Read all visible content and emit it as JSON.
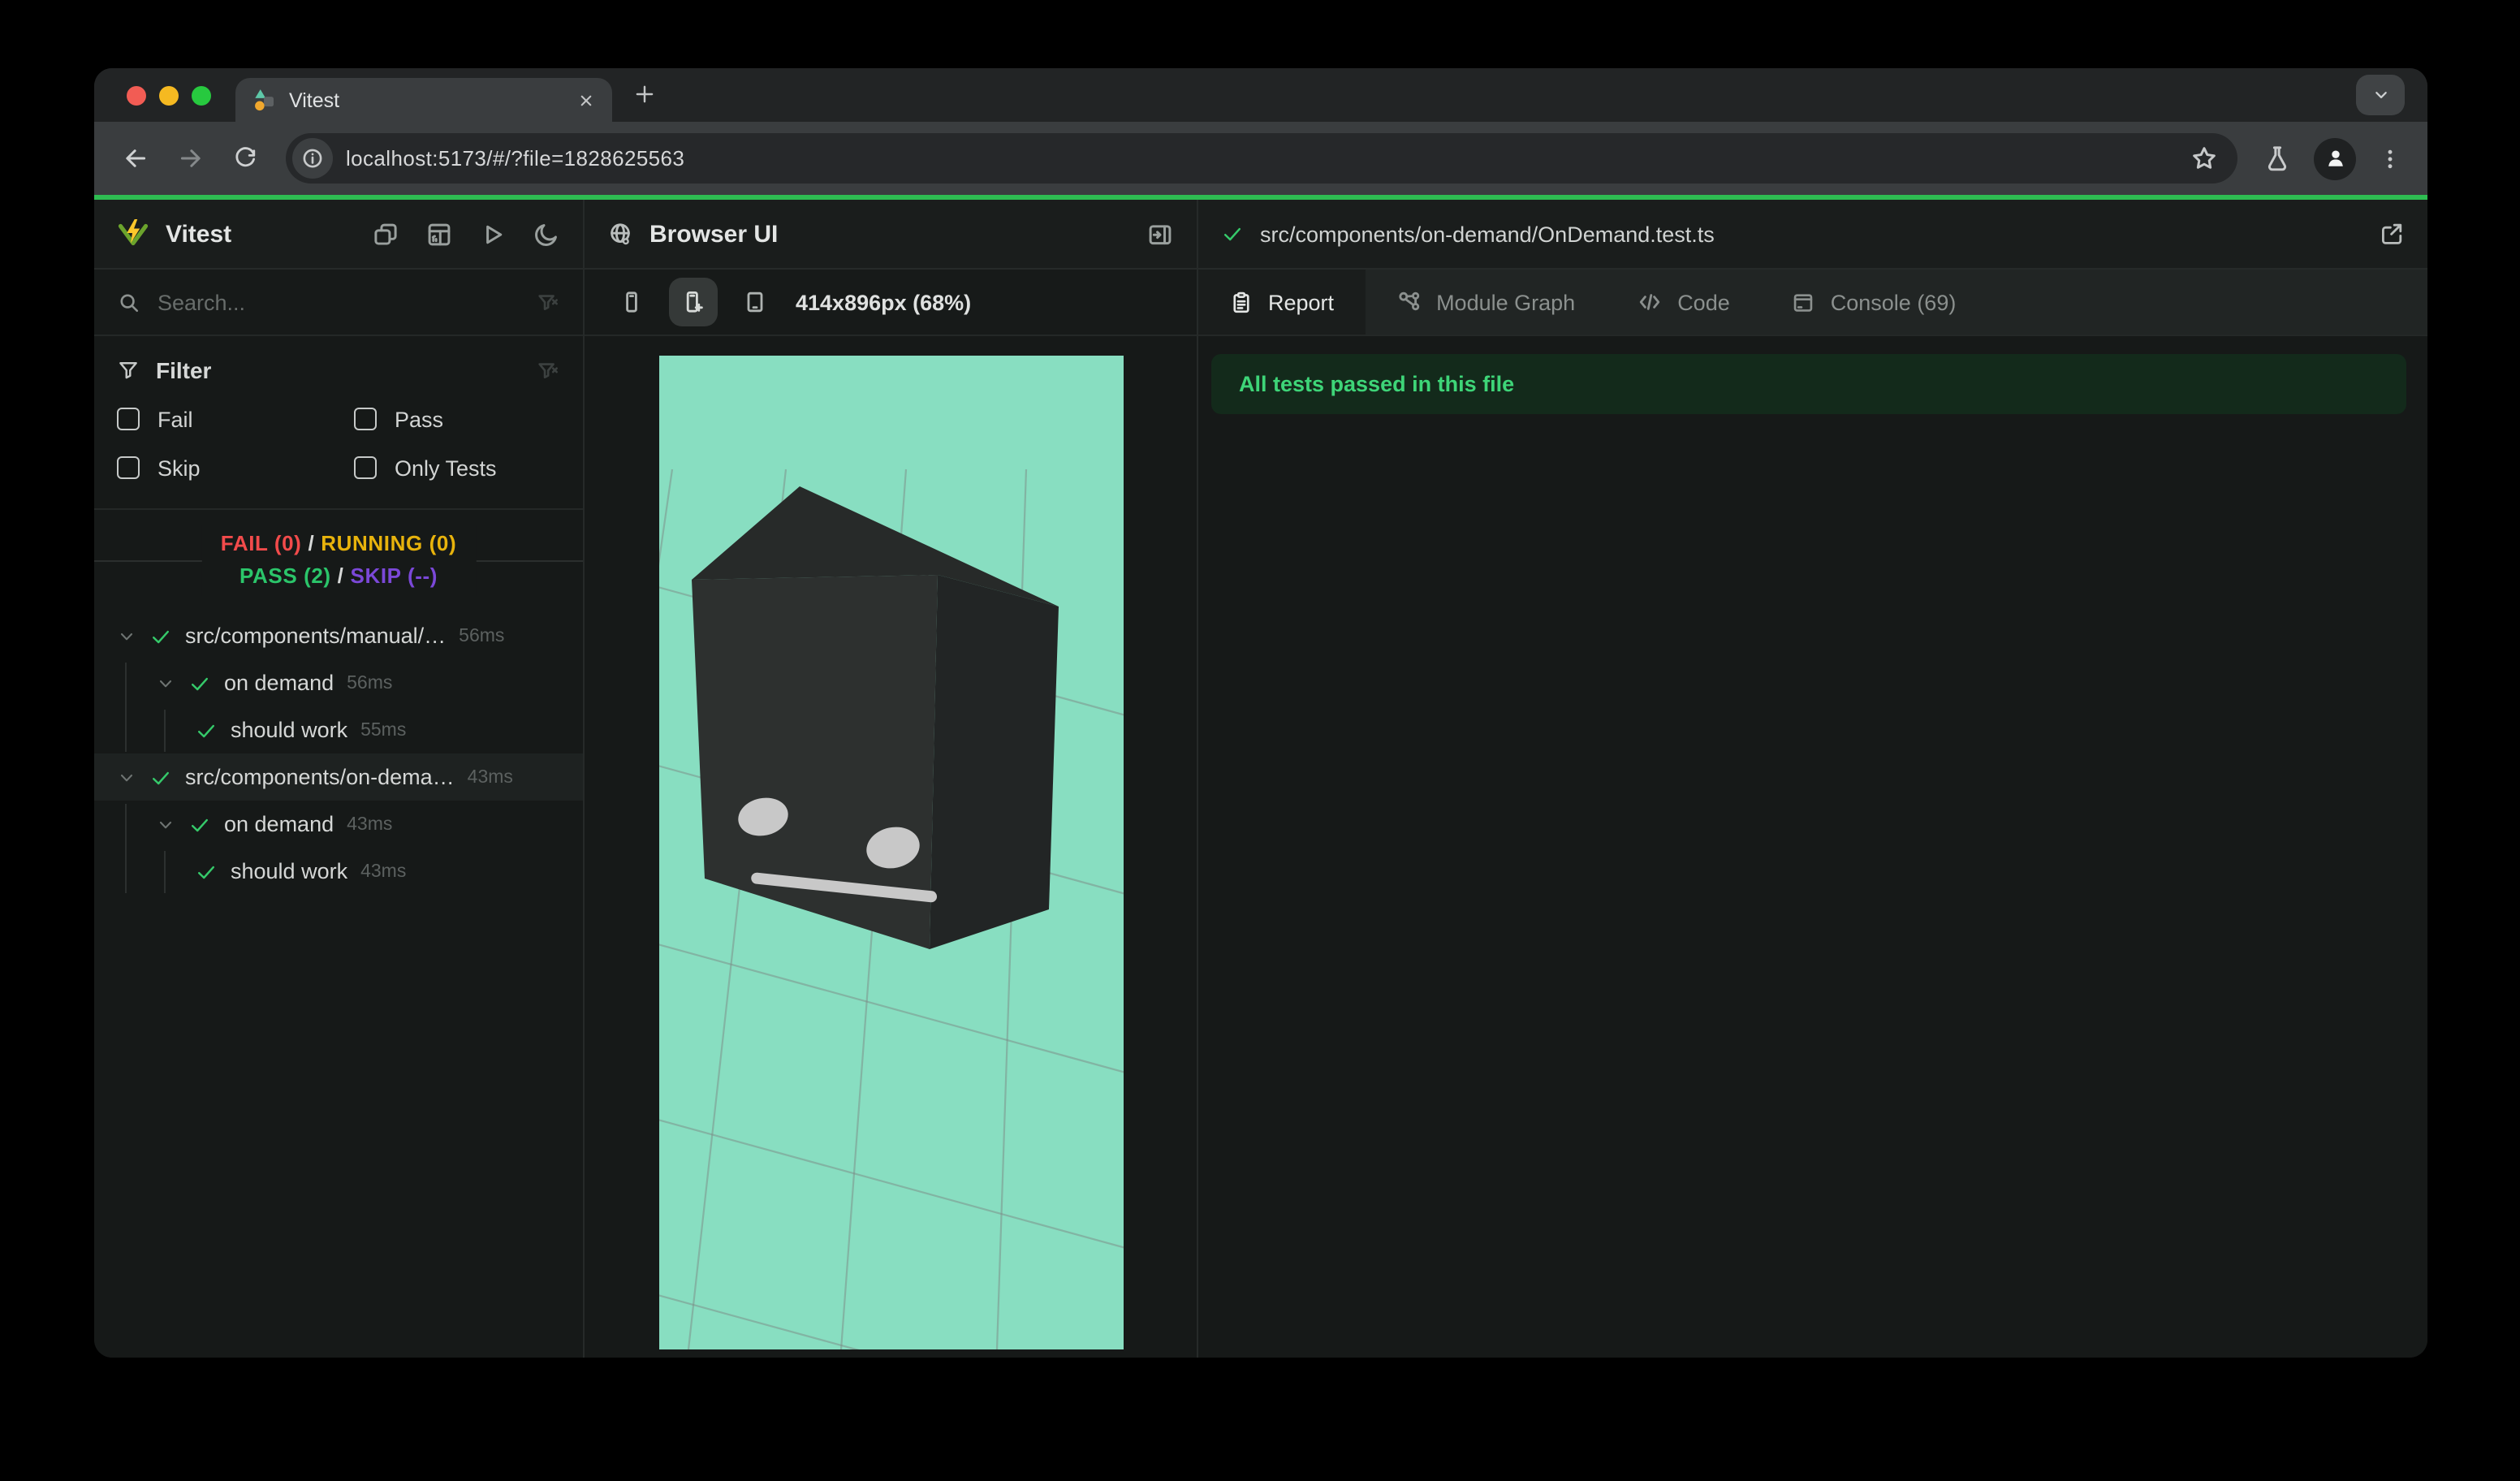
{
  "chrome": {
    "tab_title": "Vitest",
    "url": "localhost:5173/#/?file=1828625563",
    "icons": {
      "close": "close-icon",
      "new_tab": "plus-icon",
      "tab_search": "tab-chevron-icon",
      "back": "back-icon",
      "forward": "forward-icon",
      "reload": "reload-icon",
      "site_info": "info-icon",
      "bookmark": "star-icon",
      "experiments": "flask-icon",
      "profile": "person-icon",
      "menu": "kebab-icon",
      "favicon": "vitest-favicon"
    },
    "traffic_lights": [
      "#f25c54",
      "#f5b921",
      "#27c93f"
    ]
  },
  "sidebar": {
    "title": "Vitest",
    "logo_icon": "vitest-logo",
    "header_icons": [
      "windows-icon",
      "report-grid-icon",
      "play-icon",
      "moon-icon"
    ],
    "search": {
      "placeholder": "Search...",
      "icon": "search-icon",
      "clear_icon": "funnel-x-icon"
    },
    "filter": {
      "heading": "Filter",
      "icon": "funnel-icon",
      "clear_icon": "funnel-x-icon",
      "options": [
        {
          "label": "Fail",
          "checked": false
        },
        {
          "label": "Pass",
          "checked": false
        },
        {
          "label": "Skip",
          "checked": false
        },
        {
          "label": "Only Tests",
          "checked": false
        }
      ]
    },
    "summary": {
      "fail": "FAIL (0)",
      "running": "RUNNING (0)",
      "pass": "PASS (2)",
      "skip": "SKIP (--)",
      "separator": "/"
    },
    "tree": [
      {
        "depth": 0,
        "type": "file",
        "label": "src/components/manual/…",
        "duration": "56ms",
        "selected": false
      },
      {
        "depth": 1,
        "type": "suite",
        "label": "on demand",
        "duration": "56ms",
        "selected": false
      },
      {
        "depth": 2,
        "type": "test",
        "label": "should work",
        "duration": "55ms",
        "selected": false
      },
      {
        "depth": 0,
        "type": "file",
        "label": "src/components/on-dema…",
        "duration": "43ms",
        "selected": true
      },
      {
        "depth": 1,
        "type": "suite",
        "label": "on demand",
        "duration": "43ms",
        "selected": false
      },
      {
        "depth": 2,
        "type": "test",
        "label": "should work",
        "duration": "43ms",
        "selected": false
      }
    ]
  },
  "browser_panel": {
    "title": "Browser UI",
    "title_icon": "globe-icon",
    "collapse_icon": "panel-right-icon",
    "viewport_label": "414x896px (68%)",
    "device_buttons": [
      {
        "icon": "phone-icon",
        "active": false
      },
      {
        "icon": "phone-plus-icon",
        "active": true
      },
      {
        "icon": "tablet-minus-icon",
        "active": false
      }
    ],
    "scene": {
      "description": "dark cube robot face on teal grid floor"
    }
  },
  "report_panel": {
    "file_status_icon": "check-icon",
    "file_path": "src/components/on-demand/OnDemand.test.ts",
    "open_external_icon": "external-link-icon",
    "tabs": [
      {
        "label": "Report",
        "icon": "clipboard-icon",
        "active": true
      },
      {
        "label": "Module Graph",
        "icon": "module-graph-icon",
        "active": false
      },
      {
        "label": "Code",
        "icon": "code-icon",
        "active": false
      },
      {
        "label": "Console (69)",
        "icon": "console-icon",
        "active": false
      }
    ],
    "banner": "All tests passed in this file"
  },
  "colors": {
    "progress_green": "#2ebd52",
    "fail_red": "#f24b4b",
    "running_yellow": "#e8b30c",
    "pass_green": "#2bc56a",
    "skip_purple": "#7b48d8",
    "canvas_teal": "#88dec1",
    "banner_bg": "#132a1b",
    "banner_text": "#3ed578"
  }
}
